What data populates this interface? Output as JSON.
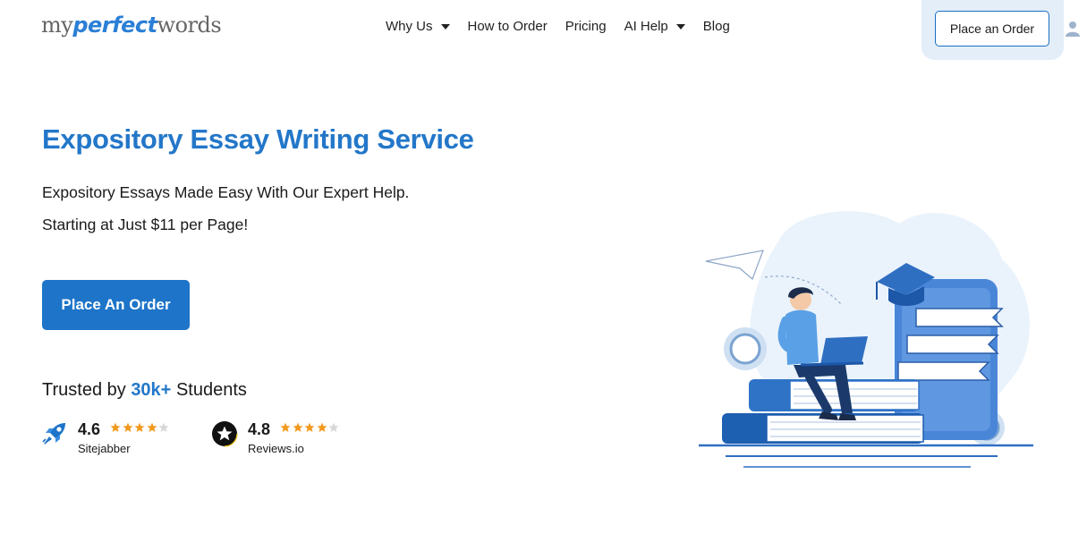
{
  "header": {
    "logo": {
      "part1": "my",
      "part2": "perfect",
      "part3": "words"
    },
    "nav": [
      {
        "label": "Why Us",
        "has_dropdown": true
      },
      {
        "label": "How to Order",
        "has_dropdown": false
      },
      {
        "label": "Pricing",
        "has_dropdown": false
      },
      {
        "label": "AI Help",
        "has_dropdown": true
      },
      {
        "label": "Blog",
        "has_dropdown": false
      }
    ],
    "order_button": "Place an Order",
    "user_icon": "user-icon"
  },
  "hero": {
    "title": "Expository Essay Writing Service",
    "subtitle_line1": "Expository Essays Made Easy With Our Expert Help.",
    "subtitle_line2": "Starting at Just $11 per Page!",
    "cta": "Place An Order",
    "trusted_prefix": "Trusted by",
    "trusted_count": "30k+",
    "trusted_suffix": "Students"
  },
  "ratings": [
    {
      "score": "4.6",
      "source": "Sitejabber",
      "stars": 4.6,
      "icon": "rocket-icon"
    },
    {
      "score": "4.8",
      "source": "Reviews.io",
      "stars": 4.8,
      "icon": "star-badge-icon"
    }
  ],
  "colors": {
    "brand_blue": "#2377c9",
    "button_blue": "#1d74c8",
    "star_orange": "#f29a1f",
    "star_grey": "#d8d8d8",
    "order_bg": "#e3eef9"
  }
}
